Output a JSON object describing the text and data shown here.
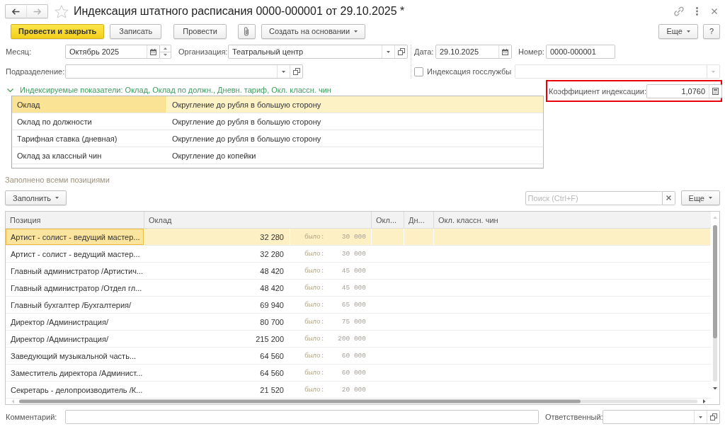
{
  "window": {
    "title": "Индексация штатного расписания 0000-000001 от 29.10.2025 *",
    "favorite": false,
    "back": {
      "disabled": false
    },
    "forward": {
      "disabled": true
    }
  },
  "toolbar": {
    "buttons": [
      {
        "kind": "primary",
        "label": "Провести и закрыть"
      },
      {
        "kind": "plain",
        "label": "Записать"
      },
      {
        "kind": "plain",
        "label": "Провести"
      },
      {
        "kind": "attach"
      },
      {
        "kind": "menu",
        "label": "Создать на основании"
      }
    ],
    "right_buttons": [
      {
        "kind": "menu",
        "label": "Еще"
      },
      {
        "kind": "plain",
        "label": "?"
      }
    ]
  },
  "header": {
    "month": {
      "label": "Месяц:",
      "value": "Октябрь 2025"
    },
    "organization": {
      "label": "Организация:",
      "value": "Театральный центр"
    },
    "date": {
      "label": "Дата:",
      "value": "29.10.2025"
    },
    "number": {
      "label": "Номер:",
      "value": "0000-000001"
    },
    "department": {
      "label": "Подразделение:"
    },
    "civil_service_indexing": {
      "label": "Индексация госслужбы",
      "checked": false,
      "field_disabled": true
    }
  },
  "indexed_indicators": {
    "summary": "Индексируемые показатели: Оклад, Оклад по должн., Дневн. тариф, Окл. классн. чин",
    "expanded": true,
    "rows": [
      {
        "indicator": "Оклад",
        "rounding": "Округление до рубля в большую сторону",
        "selected": true
      },
      {
        "indicator": "Оклад по должности",
        "rounding": "Округление до рубля в большую сторону",
        "selected": false
      },
      {
        "indicator": "Тарифная ставка (дневная)",
        "rounding": "Округление до рубля в большую сторону",
        "selected": false
      },
      {
        "indicator": "Оклад за классный чин",
        "rounding": "Округление до копейки",
        "selected": false
      }
    ]
  },
  "coefficient": {
    "label": "Коэффициент индексации:",
    "value": "1,0760",
    "highlighted": true
  },
  "fill_status": "Заполнено всеми позициями",
  "positions": {
    "fill_button": "Заполнить",
    "search": {
      "placeholder": "Поиск (Ctrl+F)"
    },
    "more_button": "Еще",
    "columns": [
      "Позиция",
      "Оклад",
      "Окл...",
      "Дн...",
      "Окл. классн. чин"
    ],
    "rows": [
      {
        "position": "Артист - солист - ведущий мастер...",
        "salary": "32 280",
        "was_label": "было:",
        "was_value": "30 000",
        "selected": true
      },
      {
        "position": "Артист - солист - ведущий мастер...",
        "salary": "32 280",
        "was_label": "было:",
        "was_value": "30 000",
        "selected": false
      },
      {
        "position": "Главный администратор /Артистич...",
        "salary": "48 420",
        "was_label": "было:",
        "was_value": "45 000",
        "selected": false
      },
      {
        "position": "Главный администратор /Отдел гл...",
        "salary": "48 420",
        "was_label": "было:",
        "was_value": "45 000",
        "selected": false
      },
      {
        "position": "Главный бухгалтер /Бухгалтерия/",
        "salary": "69 940",
        "was_label": "было:",
        "was_value": "65 000",
        "selected": false
      },
      {
        "position": "Директор /Администрация/",
        "salary": "80 700",
        "was_label": "было:",
        "was_value": "75 000",
        "selected": false
      },
      {
        "position": "Директор /Администрация/",
        "salary": "215 200",
        "was_label": "было:",
        "was_value": "200 000",
        "selected": false
      },
      {
        "position": "Заведующий музыкальной часть...",
        "salary": "64 560",
        "was_label": "было:",
        "was_value": "60 000",
        "selected": false
      },
      {
        "position": "Заместитель директора /Админист...",
        "salary": "64 560",
        "was_label": "было:",
        "was_value": "60 000",
        "selected": false
      },
      {
        "position": "Секретарь - делопроизводитель /К...",
        "salary": "21 520",
        "was_label": "было:",
        "was_value": "20 000",
        "selected": false
      }
    ]
  },
  "footer": {
    "comment": {
      "label": "Комментарий:"
    },
    "responsible": {
      "label": "Ответственный:"
    }
  }
}
